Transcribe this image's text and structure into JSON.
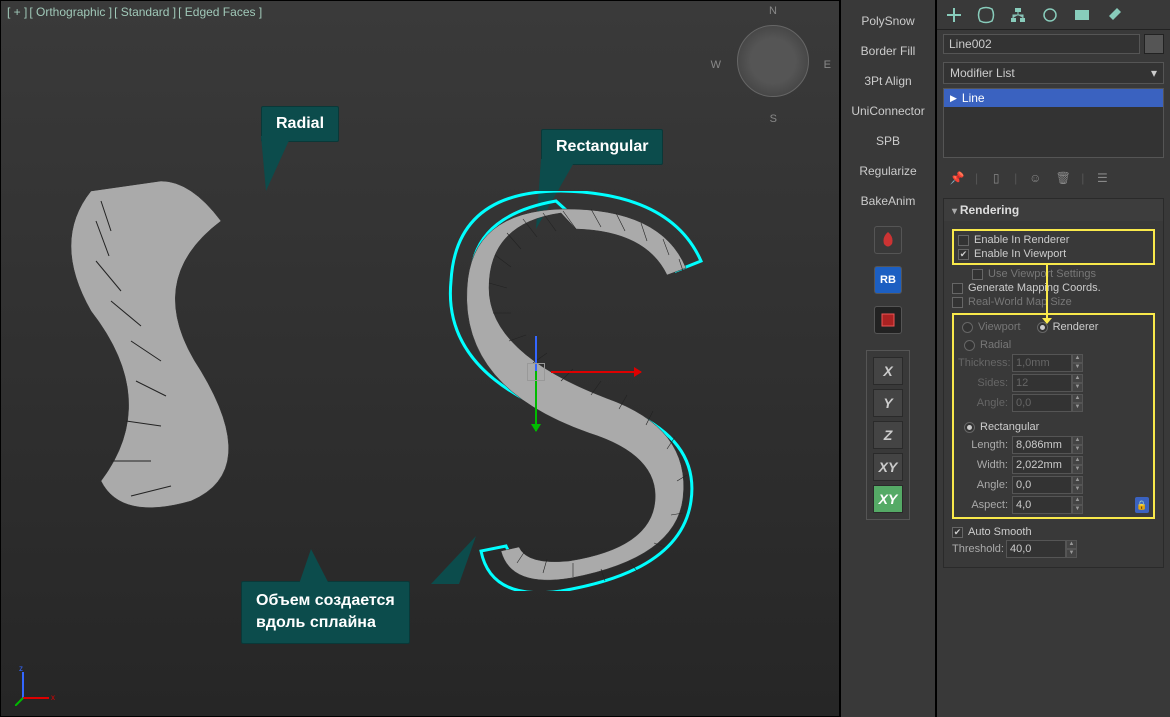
{
  "viewport": {
    "labels": [
      "[ + ]",
      "[ Orthographic ]",
      "[ Standard ]",
      "[ Edged Faces ]"
    ],
    "nav": {
      "n": "N",
      "s": "S",
      "e": "E",
      "w": "W"
    }
  },
  "callouts": {
    "radial": "Radial",
    "rectangular": "Rectangular",
    "volume": "Объем создается\nвдоль сплайна"
  },
  "tools_panel": {
    "items": [
      "PolySnow",
      "Border Fill",
      "3Pt Align",
      "UniConnector",
      "SPB",
      "Regularize",
      "BakeAnim"
    ],
    "rb": "RB",
    "axis": [
      "X",
      "Y",
      "Z",
      "XY",
      "XY"
    ]
  },
  "right": {
    "object_name": "Line002",
    "modifier_dropdown": "Modifier List",
    "stack_item": "Line",
    "rollout_title": "Rendering",
    "enable_renderer": "Enable In Renderer",
    "enable_viewport": "Enable In Viewport",
    "use_viewport_settings": "Use Viewport Settings",
    "gen_mapping": "Generate Mapping Coords.",
    "real_world": "Real-World Map Size",
    "viewport_radio": "Viewport",
    "renderer_radio": "Renderer",
    "radial": "Radial",
    "radial_params": {
      "thickness": {
        "label": "Thickness:",
        "value": "1,0mm"
      },
      "sides": {
        "label": "Sides:",
        "value": "12"
      },
      "angle": {
        "label": "Angle:",
        "value": "0,0"
      }
    },
    "rectangular": "Rectangular",
    "rect_params": {
      "length": {
        "label": "Length:",
        "value": "8,086mm"
      },
      "width": {
        "label": "Width:",
        "value": "2,022mm"
      },
      "angle": {
        "label": "Angle:",
        "value": "0,0"
      },
      "aspect": {
        "label": "Aspect:",
        "value": "4,0"
      }
    },
    "auto_smooth": "Auto Smooth",
    "threshold": {
      "label": "Threshold:",
      "value": "40,0"
    }
  }
}
